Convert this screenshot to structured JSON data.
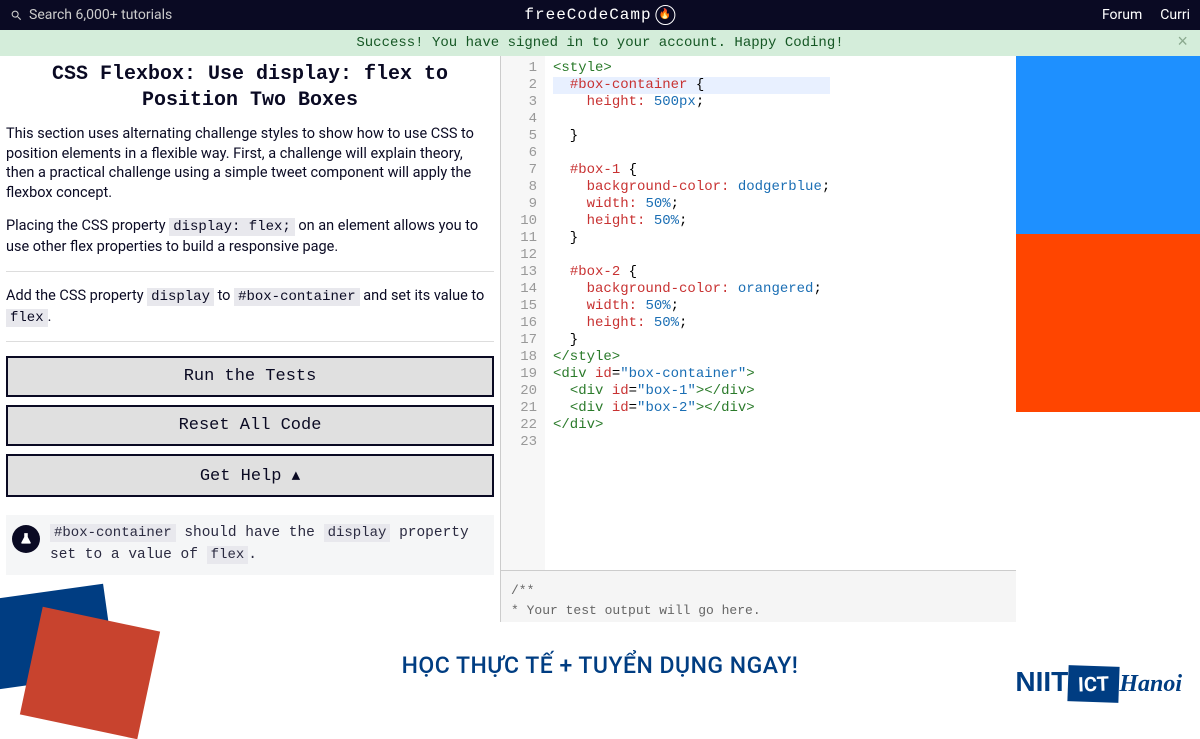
{
  "topbar": {
    "search_placeholder": "Search 6,000+ tutorials",
    "brand": "freeCodeCamp",
    "links": {
      "forum": "Forum",
      "curri": "Curri"
    }
  },
  "banner": {
    "text": "Success! You have signed in to your account. Happy Coding!"
  },
  "challenge": {
    "title": "CSS Flexbox: Use display: flex to Position Two Boxes",
    "p1": "This section uses alternating challenge styles to show how to use CSS to position elements in a flexible way. First, a challenge will explain theory, then a practical challenge using a simple tweet component will apply the flexbox concept.",
    "p2a": "Placing the CSS property ",
    "p2_code": "display: flex;",
    "p2b": " on an element allows you to use other flex properties to build a responsive page.",
    "p3a": "Add the CSS property ",
    "p3_c1": "display",
    "p3b": " to ",
    "p3_c2": "#box-container",
    "p3c": " and set its value to ",
    "p3_c3": "flex",
    "p3d": ".",
    "btn_run": "Run the Tests",
    "btn_reset": "Reset All Code",
    "btn_help": "Get Help ▴",
    "test_a": "#box-container",
    "test_b": " should have the ",
    "test_c": "display",
    "test_d": " property set to a value of ",
    "test_e": "flex",
    "test_f": "."
  },
  "editor": {
    "lines": [
      "1",
      "2",
      "3",
      "4",
      "5",
      "6",
      "7",
      "8",
      "9",
      "10",
      "11",
      "12",
      "13",
      "14",
      "15",
      "16",
      "17",
      "18",
      "19",
      "20",
      "21",
      "22",
      "23"
    ]
  },
  "output": {
    "l1": "/**",
    "l2": "* Your test output will go here.",
    "l3": "*/"
  },
  "footer": {
    "slogan": "HỌC THỰC TẾ + TUYỂN DỤNG NGAY!",
    "logo_n": "NIIT",
    "logo_ict": "ICT",
    "logo_h": "Hanoi"
  }
}
